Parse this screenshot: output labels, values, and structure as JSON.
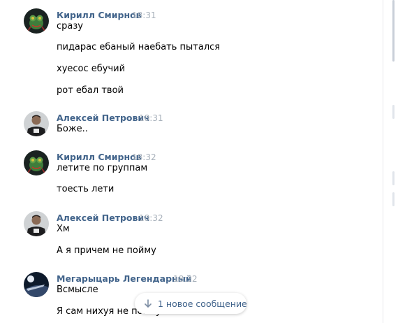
{
  "users": {
    "kirill": "Кирилл Смирнов",
    "aleksey": "Алексей Петрович",
    "megacar": "Мегарыцарь Легендарный"
  },
  "messages": [
    {
      "author": "Кирилл Смирнов",
      "time": "18:31",
      "avatar_icon": "frog-avatar-icon",
      "lines": [
        "сразу",
        "пидарас ебаный наебать пытался",
        "хуесос ебучий",
        "рот ебал твой"
      ]
    },
    {
      "author": "Алексей Петрович",
      "time": "18:31",
      "avatar_icon": "person-avatar-icon",
      "lines": [
        "Боже.."
      ]
    },
    {
      "author": "Кирилл Смирнов",
      "time": "18:32",
      "avatar_icon": "frog-avatar-icon",
      "lines": [
        "летите по группам",
        "тоесть лети"
      ]
    },
    {
      "author": "Алексей Петрович",
      "time": "18:32",
      "avatar_icon": "person-avatar-icon",
      "lines": [
        "Хм",
        "А я причем не пойму"
      ]
    },
    {
      "author": "Мегарыцарь Легендарный",
      "time": "18:32",
      "avatar_icon": "night-scene-avatar-icon",
      "lines": [
        "Всмысле",
        "Я сам нихуя не пойму"
      ]
    }
  ],
  "new_message_pill": {
    "label": "1 новое сообщение",
    "icon": "arrow-down-icon"
  },
  "colors": {
    "author": "#42648b",
    "time": "#a8b1bb",
    "pill_text": "#3f628a"
  }
}
